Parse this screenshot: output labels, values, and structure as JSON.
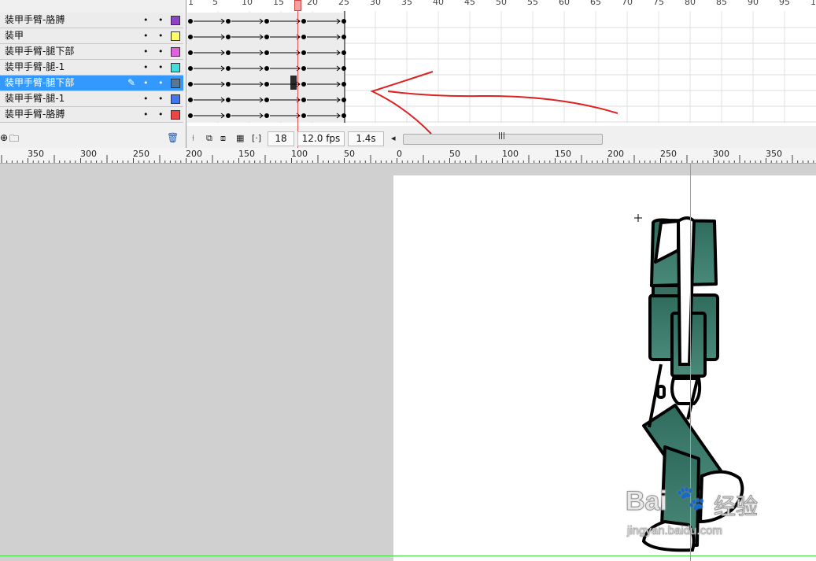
{
  "layers": [
    {
      "name": "装甲手臂-胳膊",
      "color": "#8e44c8",
      "selected": false
    },
    {
      "name": "装甲",
      "color": "#ffff66",
      "selected": false
    },
    {
      "name": "装甲手臂-腿下部",
      "color": "#e060e0",
      "selected": false
    },
    {
      "name": "装甲手臂-腿-1",
      "color": "#44dddd",
      "selected": false
    },
    {
      "name": "装甲手臂-腿下部",
      "color": "#557799",
      "selected": true
    },
    {
      "name": "装甲手臂-腿-1",
      "color": "#4477ee",
      "selected": false
    },
    {
      "name": "装甲手臂-胳膊",
      "color": "#ee4444",
      "selected": false
    }
  ],
  "frame_ruler": [
    "1",
    "5",
    "10",
    "15",
    "20",
    "25",
    "30",
    "35",
    "40",
    "45",
    "50",
    "55",
    "60",
    "65",
    "70",
    "75",
    "80",
    "85",
    "90",
    "95",
    "1"
  ],
  "timeline_status": {
    "current_frame": "18",
    "frame_rate": "12.0 fps",
    "elapsed": "1.4s"
  },
  "stage_ruler": [
    "350",
    "300",
    "250",
    "200",
    "150",
    "100",
    "50",
    "0",
    "50",
    "100",
    "150",
    "200",
    "250",
    "300",
    "350"
  ],
  "watermark": {
    "brand": "Bai",
    "brand_suffix": "经验",
    "url": "jingyan.baidu.com"
  },
  "colors": {
    "selection": "#3399ff",
    "playhead": "#e05050",
    "annotation": "#dd2222",
    "robot": "#3a7a6a",
    "guide": "#44dd44"
  }
}
